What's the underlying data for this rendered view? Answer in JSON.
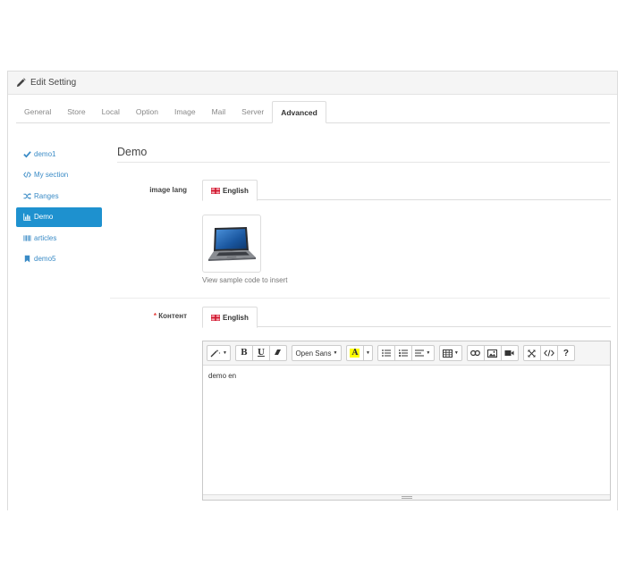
{
  "panel": {
    "title": "Edit Setting"
  },
  "tabs": [
    {
      "label": "General"
    },
    {
      "label": "Store"
    },
    {
      "label": "Local"
    },
    {
      "label": "Option"
    },
    {
      "label": "Image"
    },
    {
      "label": "Mail"
    },
    {
      "label": "Server"
    },
    {
      "label": "Advanced",
      "active": true
    }
  ],
  "sidebar": {
    "items": [
      {
        "label": "demo1",
        "icon": "check-icon"
      },
      {
        "label": "My section",
        "icon": "code-icon"
      },
      {
        "label": "Ranges",
        "icon": "random-icon"
      },
      {
        "label": "Demo",
        "icon": "bar-chart-icon",
        "active": true
      },
      {
        "label": "articles",
        "icon": "barcode-icon"
      },
      {
        "label": "demo5",
        "icon": "bookmark-icon"
      }
    ]
  },
  "main": {
    "section_title": "Demo",
    "image_field": {
      "label": "image lang",
      "lang_tab": "English",
      "image_icon": "laptop-image",
      "help": "View sample code to insert"
    },
    "content_field": {
      "required_mark": "*",
      "label": "Контент",
      "lang_tab": "English",
      "toolbar": {
        "font_name": "Open Sans",
        "color_letter": "A"
      },
      "value": "demo en"
    }
  },
  "colors": {
    "accent": "#1e91cf",
    "link": "#3a8bc6",
    "required": "#e53935",
    "highlight": "#ffff00"
  }
}
